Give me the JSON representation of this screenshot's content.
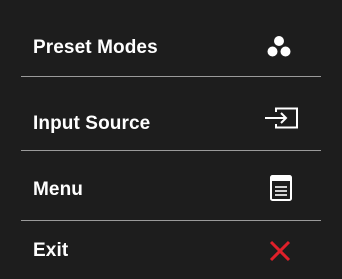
{
  "menu": {
    "items": [
      {
        "label": "Preset Modes",
        "icon": "three-dots-icon"
      },
      {
        "label": "Input Source",
        "icon": "input-source-icon"
      },
      {
        "label": "Menu",
        "icon": "menu-document-icon"
      },
      {
        "label": "Exit",
        "icon": "close-icon"
      }
    ]
  },
  "colors": {
    "background": "#1d1d1d",
    "text": "#ffffff",
    "divider": "#9a9a9a",
    "exit_accent": "#e0202a"
  }
}
